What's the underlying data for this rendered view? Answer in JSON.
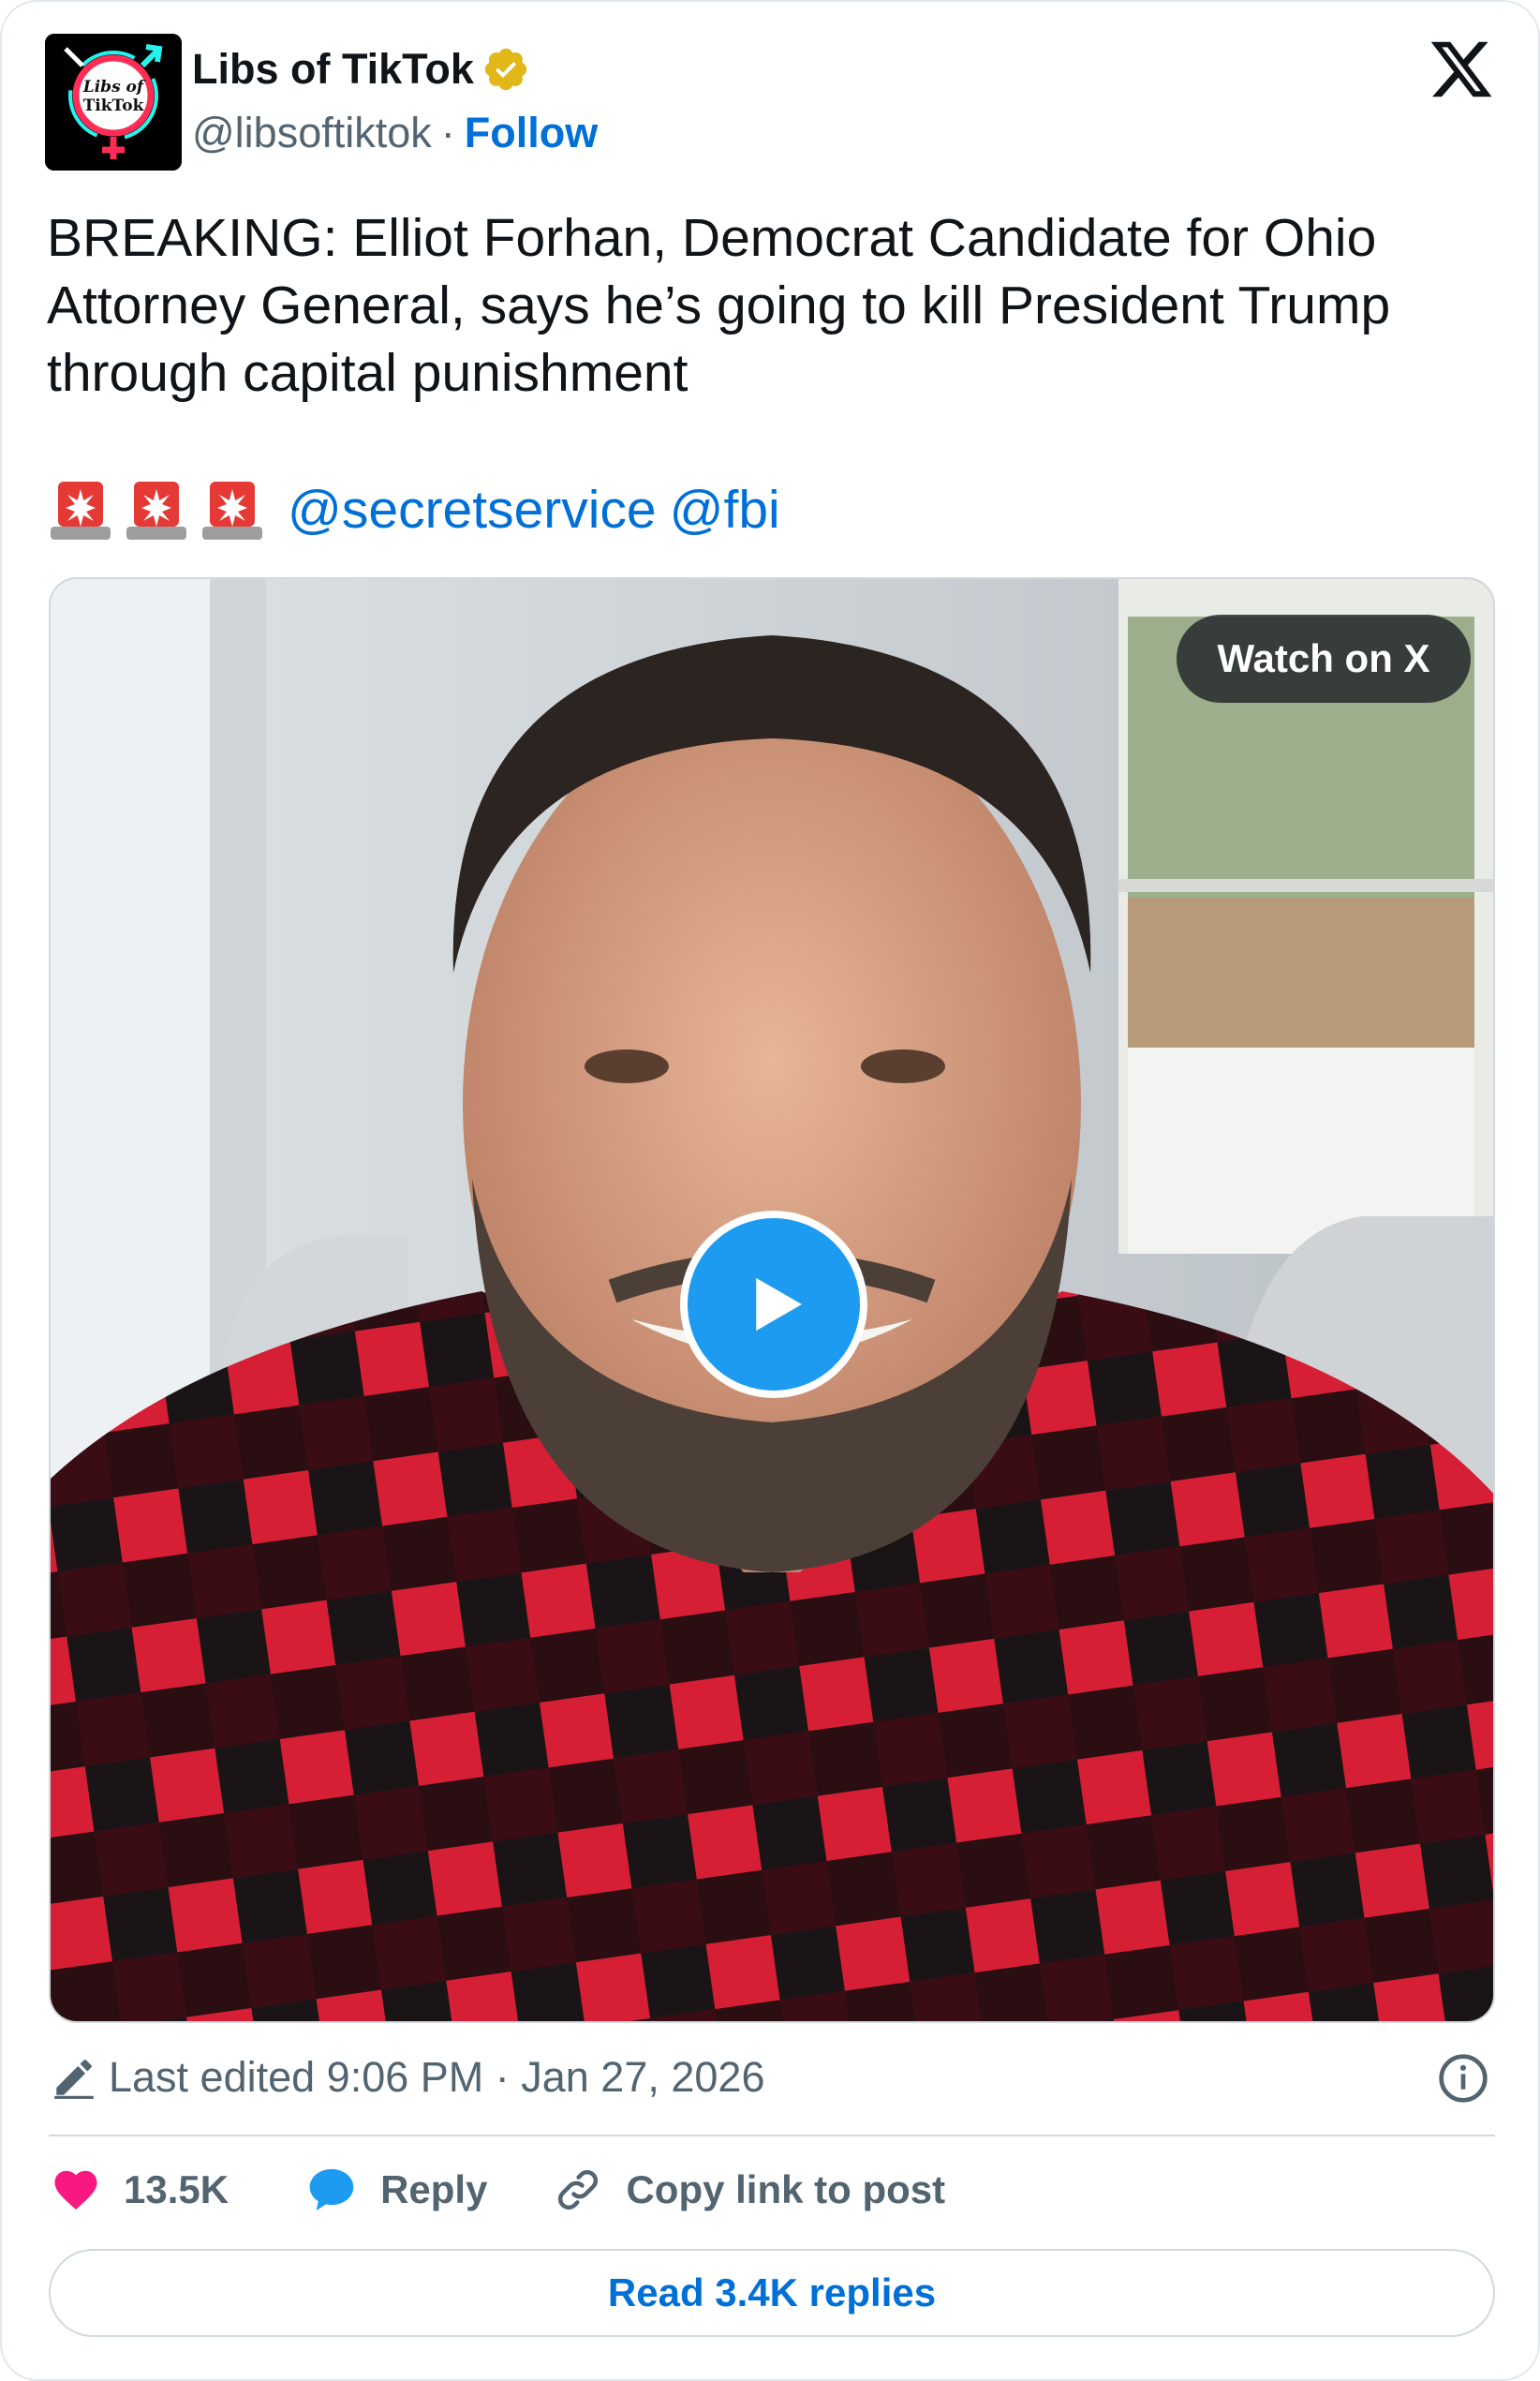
{
  "author": {
    "name": "Libs of TikTok",
    "handle": "@libsoftiktok",
    "separator": "·",
    "follow_label": "Follow",
    "avatar_text_line1": "Libs of",
    "avatar_text_line2": "TikTok",
    "verified_color": "#e2b719"
  },
  "post": {
    "text": "BREAKING: Elliot Forhan, Democrat Candidate for Ohio Attorney General, says he’s going to kill President Trump through capital punishment",
    "emoji_icons": [
      "police-siren-icon",
      "police-siren-icon",
      "police-siren-icon"
    ],
    "mentions": [
      "@secretservice",
      "@fbi"
    ]
  },
  "media": {
    "watch_label": "Watch on X",
    "play_icon": "play-icon"
  },
  "meta": {
    "edited_text": "Last edited 9:06 PM · Jan 27, 2026"
  },
  "actions": {
    "likes": "13.5K",
    "reply_label": "Reply",
    "copy_label": "Copy link to post"
  },
  "read_replies_label": "Read 3.4K replies",
  "colors": {
    "link": "#006fd6",
    "play": "#1d9bf0",
    "like": "#f91880",
    "reply": "#1d9bf0"
  }
}
